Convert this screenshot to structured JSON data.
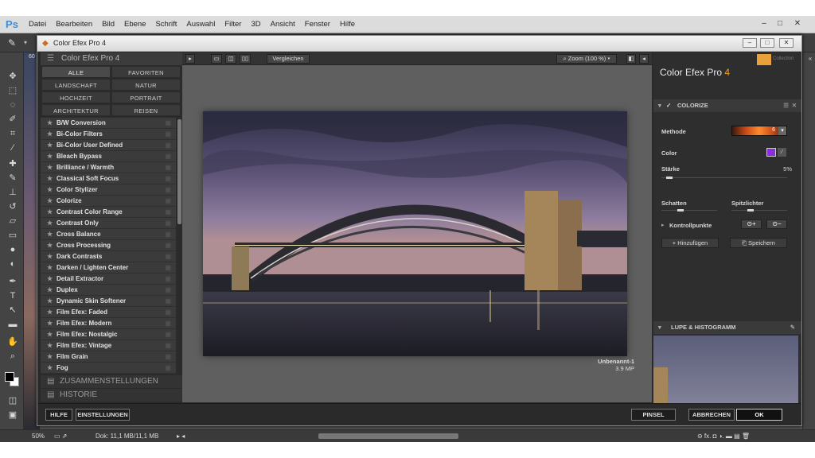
{
  "menubar": {
    "app_logo": "Ps",
    "items": [
      "Datei",
      "Bearbeiten",
      "Bild",
      "Ebene",
      "Schrift",
      "Auswahl",
      "Filter",
      "3D",
      "Ansicht",
      "Fenster",
      "Hilfe"
    ]
  },
  "document": {
    "zoom": "60"
  },
  "plugin": {
    "window_title": "Color Efex Pro 4",
    "left_header": "Color Efex Pro 4",
    "categories": [
      "ALLE",
      "FAVORITEN",
      "LANDSCHAFT",
      "NATUR",
      "HOCHZEIT",
      "PORTRAIT",
      "ARCHITEKTUR",
      "REISEN"
    ],
    "filters": [
      "B/W Conversion",
      "Bi-Color Filters",
      "Bi-Color User Defined",
      "Bleach Bypass",
      "Brilliance / Warmth",
      "Classical Soft Focus",
      "Color Stylizer",
      "Colorize",
      "Contrast Color Range",
      "Contrast Only",
      "Cross Balance",
      "Cross Processing",
      "Dark Contrasts",
      "Darken / Lighten Center",
      "Detail Extractor",
      "Duplex",
      "Dynamic Skin Softener",
      "Film Efex: Faded",
      "Film Efex: Modern",
      "Film Efex: Nostalgic",
      "Film Efex: Vintage",
      "Film Grain",
      "Fog"
    ],
    "sections": {
      "recipes": "ZUSAMMENSTELLUNGEN",
      "history": "HISTORIE"
    },
    "toolbar": {
      "compare": "Vergleichen",
      "zoom": "Zoom (100 %)"
    },
    "image": {
      "name": "Unbenannt-1",
      "size": "3.9 MP"
    },
    "right": {
      "title_main": "Color Efex Pro",
      "title_num": "4",
      "logo_text": "Collection",
      "filter_name": "COLORIZE",
      "method_label": "Methode",
      "method_value": "6",
      "color_label": "Color",
      "color_value": "#8b2be2",
      "strength_label": "Stärke",
      "strength_value": "5%",
      "shadows_label": "Schatten",
      "highlights_label": "Spitzlichter",
      "control_points_label": "Kontrollpunkte",
      "add_label": "Hinzufügen",
      "save_label": "Speichern",
      "loupe_label": "LUPE & HISTOGRAMM"
    },
    "bottom": {
      "help": "HILFE",
      "settings": "EINSTELLUNGEN",
      "brush": "PINSEL",
      "cancel": "ABBRECHEN",
      "ok": "OK"
    }
  },
  "status": {
    "zoom": "50%",
    "doc": "Dok: 11,1 MB/11,1 MB"
  }
}
